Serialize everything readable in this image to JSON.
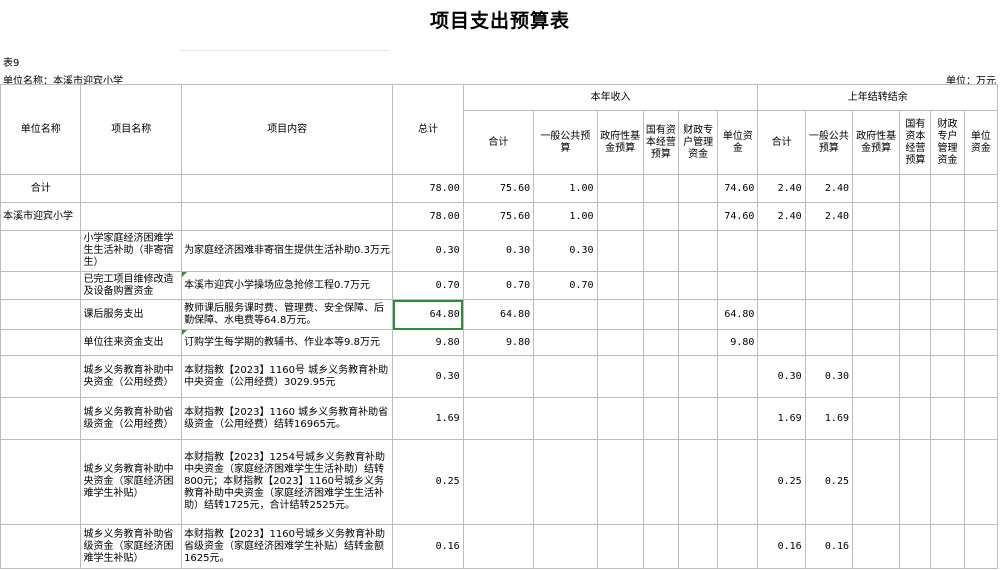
{
  "title": "项目支出预算表",
  "table_no": "表9",
  "unit_name": "单位名称：本溪市迎宾小学",
  "unit_label": "单位：万元",
  "headers": {
    "unit": "单位名称",
    "project": "项目名称",
    "content": "项目内容",
    "total": "总计",
    "this_year": "本年收入",
    "last_year": "上年结转结余",
    "subtotal": "合计",
    "general": "一般公共预算",
    "fund": "政府性基金预算",
    "state_capital": "国有资本经营预算",
    "special": "财政专户管理资金",
    "unit_funds": "单位资金",
    "ly_subtotal": "合计",
    "ly_general": "一般公共预算",
    "ly_fund": "政府性基金预算",
    "ly_state_capital": "国有资本经营预算",
    "ly_special": "财政专户管理资金",
    "ly_unit_funds": "单位资金"
  },
  "rows": [
    {
      "unit": "合计",
      "project": "",
      "content": "",
      "total": "78.00",
      "sub": "75.60",
      "gen": "1.00",
      "fund": "",
      "cap": "",
      "spec": "",
      "ufund": "74.60",
      "ly_sub": "2.40",
      "ly_gen": "2.40",
      "ly_fund": "",
      "ly_cap": "",
      "ly_spec": "",
      "ly_ufund": ""
    },
    {
      "unit": "本溪市迎宾小学",
      "project": "",
      "content": "",
      "total": "78.00",
      "sub": "75.60",
      "gen": "1.00",
      "fund": "",
      "cap": "",
      "spec": "",
      "ufund": "74.60",
      "ly_sub": "2.40",
      "ly_gen": "2.40",
      "ly_fund": "",
      "ly_cap": "",
      "ly_spec": "",
      "ly_ufund": ""
    },
    {
      "unit": "",
      "project": "小学家庭经济困难学生生活补助（非寄宿生）",
      "content": "为家庭经济困难非寄宿生提供生活补助0.3万元",
      "total": "0.30",
      "sub": "0.30",
      "gen": "0.30",
      "fund": "",
      "cap": "",
      "spec": "",
      "ufund": "",
      "ly_sub": "",
      "ly_gen": "",
      "ly_fund": "",
      "ly_cap": "",
      "ly_spec": "",
      "ly_ufund": ""
    },
    {
      "unit": "",
      "project": "已完工项目维修改造及设备购置资金",
      "content": "本溪市迎宾小学操场应急抢修工程0.7万元",
      "total": "0.70",
      "sub": "0.70",
      "gen": "0.70",
      "fund": "",
      "cap": "",
      "spec": "",
      "ufund": "",
      "ly_sub": "",
      "ly_gen": "",
      "ly_fund": "",
      "ly_cap": "",
      "ly_spec": "",
      "ly_ufund": ""
    },
    {
      "unit": "",
      "project": "课后服务支出",
      "content": "教师课后服务课时费、管理费、安全保障、后勤保障、水电费等64.8万元。",
      "total": "64.80",
      "sub": "64.80",
      "gen": "",
      "fund": "",
      "cap": "",
      "spec": "",
      "ufund": "64.80",
      "ly_sub": "",
      "ly_gen": "",
      "ly_fund": "",
      "ly_cap": "",
      "ly_spec": "",
      "ly_ufund": ""
    },
    {
      "unit": "",
      "project": "单位往来资金支出",
      "content": "订购学生每学期的教辅书、作业本等9.8万元",
      "total": "9.80",
      "sub": "9.80",
      "gen": "",
      "fund": "",
      "cap": "",
      "spec": "",
      "ufund": "9.80",
      "ly_sub": "",
      "ly_gen": "",
      "ly_fund": "",
      "ly_cap": "",
      "ly_spec": "",
      "ly_ufund": ""
    },
    {
      "unit": "",
      "project": "城乡义务教育补助中央资金（公用经费）",
      "content": "本财指教【2023】1160号 城乡义务教育补助中央资金（公用经费）3029.95元",
      "total": "0.30",
      "sub": "",
      "gen": "",
      "fund": "",
      "cap": "",
      "spec": "",
      "ufund": "",
      "ly_sub": "0.30",
      "ly_gen": "0.30",
      "ly_fund": "",
      "ly_cap": "",
      "ly_spec": "",
      "ly_ufund": ""
    },
    {
      "unit": "",
      "project": "城乡义务教育补助省级资金（公用经费）",
      "content": "本财指教【2023】1160 城乡义务教育补助省级资金（公用经费）结转16965元。",
      "total": "1.69",
      "sub": "",
      "gen": "",
      "fund": "",
      "cap": "",
      "spec": "",
      "ufund": "",
      "ly_sub": "1.69",
      "ly_gen": "1.69",
      "ly_fund": "",
      "ly_cap": "",
      "ly_spec": "",
      "ly_ufund": ""
    },
    {
      "unit": "",
      "project": "城乡义务教育补助中央资金（家庭经济困难学生补贴）",
      "content": "本财指教【2023】1254号城乡义务教育补助中央资金（家庭经济困难学生生活补助）结转800元；本财指教【2023】1160号城乡义务教育补助中央资金（家庭经济困难学生生活补助）结转1725元，合计结转2525元。",
      "total": "0.25",
      "sub": "",
      "gen": "",
      "fund": "",
      "cap": "",
      "spec": "",
      "ufund": "",
      "ly_sub": "0.25",
      "ly_gen": "0.25",
      "ly_fund": "",
      "ly_cap": "",
      "ly_spec": "",
      "ly_ufund": ""
    },
    {
      "unit": "",
      "project": "城乡义务教育补助省级资金（家庭经济困难学生补贴）",
      "content": "本财指教【2023】1160号城乡义务教育补助省级资金（家庭经济困难学生补贴）结转金额1625元。",
      "total": "0.16",
      "sub": "",
      "gen": "",
      "fund": "",
      "cap": "",
      "spec": "",
      "ufund": "",
      "ly_sub": "0.16",
      "ly_gen": "0.16",
      "ly_fund": "",
      "ly_cap": "",
      "ly_spec": "",
      "ly_ufund": ""
    }
  ]
}
